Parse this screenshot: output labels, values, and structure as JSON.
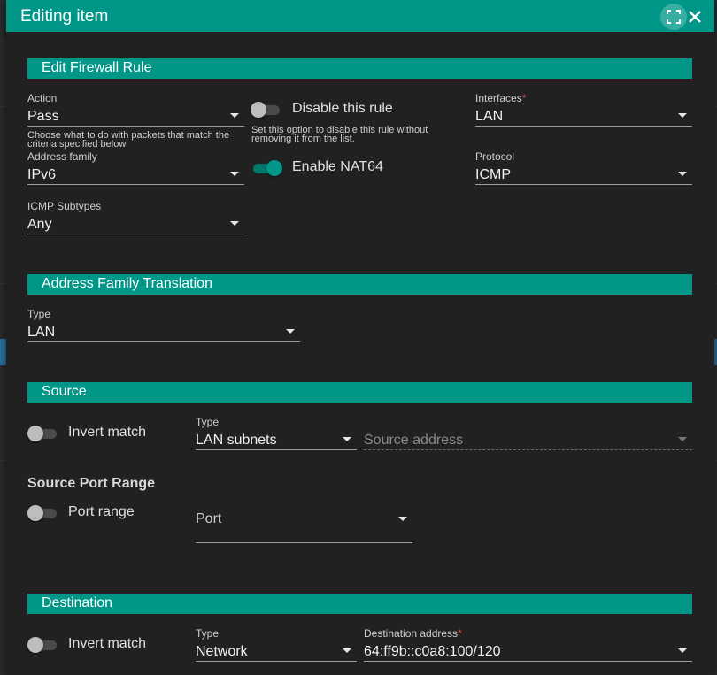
{
  "dialog": {
    "title": "Editing item"
  },
  "sections": {
    "firewall": "Edit Firewall Rule",
    "aft": "Address Family Translation",
    "source": "Source",
    "destination": "Destination"
  },
  "firewall": {
    "action": {
      "label": "Action",
      "value": "Pass",
      "hint": "Choose what to do with packets that match the criteria specified below"
    },
    "disable_rule": {
      "label": "Disable this rule",
      "on": false,
      "hint": "Set this option to disable this rule without removing it from the list."
    },
    "interfaces": {
      "label": "Interfaces",
      "required": "*",
      "value": "LAN"
    },
    "address_family": {
      "label": "Address family",
      "value": "IPv6"
    },
    "enable_nat64": {
      "label": "Enable NAT64",
      "on": true
    },
    "protocol": {
      "label": "Protocol",
      "value": "ICMP"
    },
    "icmp_subtypes": {
      "label": "ICMP Subtypes",
      "value": "Any"
    }
  },
  "aft": {
    "type": {
      "label": "Type",
      "value": "LAN"
    }
  },
  "source": {
    "invert_match": {
      "label": "Invert match",
      "on": false
    },
    "type": {
      "label": "Type",
      "value": "LAN subnets"
    },
    "address": {
      "placeholder": "Source address"
    },
    "port_range_heading": "Source Port Range",
    "port_range": {
      "label": "Port range",
      "on": false
    },
    "port": {
      "placeholder": "Port"
    }
  },
  "destination": {
    "invert_match": {
      "label": "Invert match",
      "on": false
    },
    "type": {
      "label": "Type",
      "value": "Network"
    },
    "address": {
      "label": "Destination address",
      "required": "*",
      "value": "64:ff9b::c0a8:100/120"
    }
  },
  "colors": {
    "accent": "#009688",
    "background": "#212121",
    "required": "#e05050"
  }
}
